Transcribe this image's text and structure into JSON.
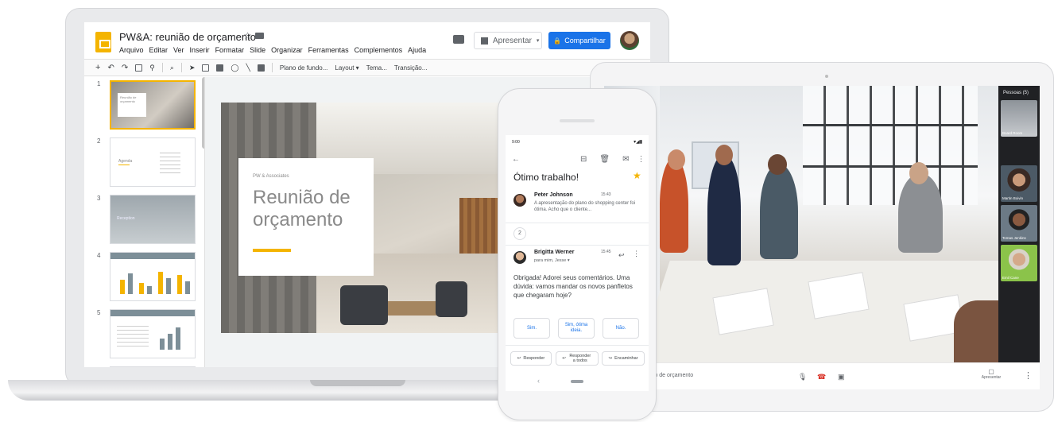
{
  "slides_app": {
    "doc_title": "PW&A: reunião de orçamento",
    "menu": [
      "Arquivo",
      "Editar",
      "Ver",
      "Inserir",
      "Formatar",
      "Slide",
      "Organizar",
      "Ferramentas",
      "Complementos",
      "Ajuda"
    ],
    "present_label": "Apresentar",
    "share_label": "Compartilhar",
    "toolbar": {
      "background": "Plano de fundo...",
      "layout": "Layout",
      "theme": "Tema...",
      "transition": "Transição..."
    },
    "filmstrip": [
      {
        "num": "1",
        "label": "Reunião de orçamento"
      },
      {
        "num": "2",
        "label": "Agenda"
      },
      {
        "num": "3",
        "label": "Reception"
      },
      {
        "num": "4",
        "label": ""
      },
      {
        "num": "5",
        "label": ""
      }
    ],
    "slide": {
      "company": "PW & Associates",
      "title_line1": "Reunião de",
      "title_line2": "orçamento"
    },
    "accent_color": "#f4b400",
    "share_color": "#1a73e8"
  },
  "gmail": {
    "status_time": "9:00",
    "subject": "Ótimo trabalho!",
    "messages": [
      {
        "from": "Peter Johnson",
        "time": "15:43",
        "snippet": "A apresentação do plano do shopping center foi ótima. Acho que o cliente..."
      },
      {
        "from": "Brigitta Werner",
        "time": "15:45",
        "to": "para mim, Jesse"
      }
    ],
    "collapsed_count": "2",
    "body": "Obrigada! Adorei seus comentários. Uma dúvida: vamos mandar os novos panfletos que chegaram hoje?",
    "smart_replies": [
      "Sim.",
      "Sim, ótima ideia.",
      "Não."
    ],
    "buttons": [
      "Responder",
      "Responder a todos",
      "Encaminhar"
    ]
  },
  "meet": {
    "people_label": "Pessoas (5)",
    "participants": [
      "Board Room",
      "Martin Boivin",
      "Tomas Jenkins",
      "Emil Cane"
    ],
    "meeting_title": "ião de orçamento",
    "present_label": "Apresentar"
  }
}
